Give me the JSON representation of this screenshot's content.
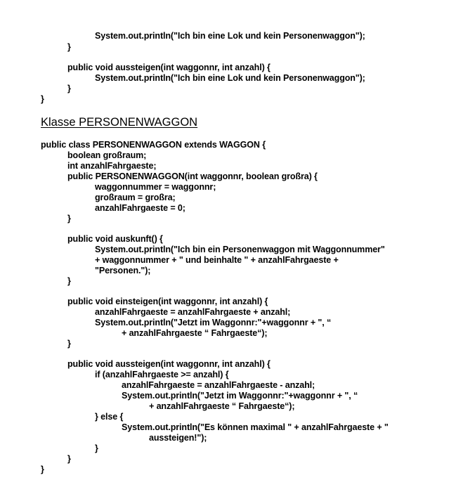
{
  "block_top": [
    "System.out.println(\"Ich bin eine Lok und kein Personenwaggon\");",
    "}",
    "public void aussteigen(int waggonnr, int anzahl) {",
    "System.out.println(\"Ich bin eine Lok und kein Personenwaggon\");",
    "}",
    "}"
  ],
  "section_heading": "Klasse PERSONENWAGGON",
  "block_main": [
    "public class PERSONENWAGGON extends WAGGON {",
    "boolean großraum;",
    "int anzahlFahrgaeste;",
    "public PERSONENWAGGON(int waggonnr, boolean großra) {",
    "waggonnummer = waggonnr;",
    "großraum = großra;",
    "anzahlFahrgaeste = 0;",
    "}",
    "public void auskunft() {",
    "System.out.println(\"Ich bin ein Personenwaggon mit Waggonnummer\"",
    "+ waggonnummer + \" und beinhalte \" + anzahlFahrgaeste +",
    "\"Personen.\");",
    "}",
    "public void einsteigen(int waggonnr, int anzahl) {",
    "anzahlFahrgaeste = anzahlFahrgaeste + anzahl;",
    "System.out.println(\"Jetzt im Waggonnr:\"+waggonnr + \", “",
    "+ anzahlFahrgaeste “ Fahrgaeste“);",
    "}",
    "public void aussteigen(int waggonnr, int anzahl) {",
    "if (anzahlFahrgaeste >= anzahl) {",
    "anzahlFahrgaeste = anzahlFahrgaeste - anzahl;",
    "System.out.println(\"Jetzt im Waggonnr:\"+waggonnr + \", “",
    "+ anzahlFahrgaeste “ Fahrgaeste“);",
    "} else {",
    "System.out.println(\"Es können maximal \" + anzahlFahrgaeste + \"",
    "aussteigen!\");",
    "}",
    "}",
    "}"
  ]
}
